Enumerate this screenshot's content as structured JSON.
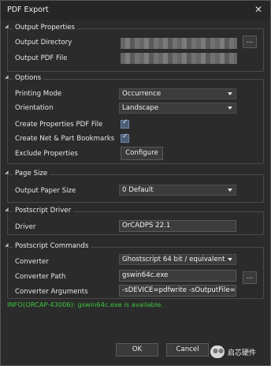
{
  "window": {
    "title": "PDF Export"
  },
  "output_properties": {
    "title": "Output Properties",
    "directory_label": "Output Directory",
    "pdf_file_label": "Output PDF File",
    "browse_label": "..."
  },
  "options": {
    "title": "Options",
    "printing_mode_label": "Printing Mode",
    "printing_mode_value": "Occurrence",
    "orientation_label": "Orientation",
    "orientation_value": "Landscape",
    "create_properties_label": "Create Properties PDF File",
    "create_properties_checked": true,
    "create_bookmarks_label": "Create Net & Part Bookmarks",
    "create_bookmarks_checked": true,
    "exclude_label": "Exclude Properties",
    "configure_label": "Configure"
  },
  "page_size": {
    "title": "Page Size",
    "paper_label": "Output Paper Size",
    "paper_value": "0 Default"
  },
  "postscript_driver": {
    "title": "Postscript Driver",
    "driver_label": "Driver",
    "driver_value": "OrCADPS 22.1"
  },
  "postscript_commands": {
    "title": "Postscript Commands",
    "converter_label": "Converter",
    "converter_value": "Ghostscript 64 bit / equivalent",
    "path_label": "Converter Path",
    "path_value": "gswin64c.exe",
    "args_label": "Converter Arguments",
    "args_value": "-sDEVICE=pdfwrite -sOutputFile=$::c",
    "browse_label": "..."
  },
  "status": {
    "info": "INFO(ORCAP-43006): gswin64c.exe is available."
  },
  "buttons": {
    "ok": "OK",
    "cancel": "Cancel"
  },
  "watermark": {
    "text": "启芯硬件"
  }
}
